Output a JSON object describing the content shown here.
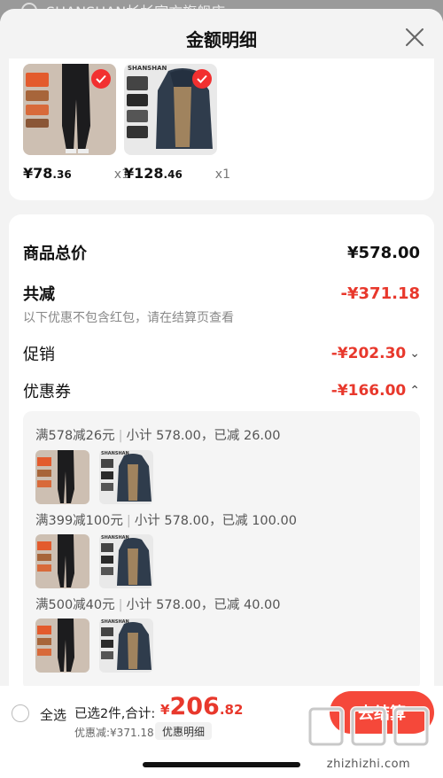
{
  "background_page": {
    "store_name": "SHANSHAN杉杉官方旗舰店 ›"
  },
  "sheet": {
    "title": "金额明细"
  },
  "products": [
    {
      "price_int": "¥78",
      "price_dec": ".36",
      "qty": "x1",
      "brand": ""
    },
    {
      "price_int": "¥128",
      "price_dec": ".46",
      "qty": "x1",
      "brand": "SHANSHAN"
    }
  ],
  "summary": {
    "goods_total_label": "商品总价",
    "goods_total_value": "¥578.00",
    "reduce_label": "共减",
    "reduce_value": "-¥371.18",
    "reduce_note": "以下优惠不包含红包，请在结算页查看",
    "promo_label": "促销",
    "promo_value": "-¥202.30",
    "coupon_label": "优惠券",
    "coupon_value": "-¥166.00"
  },
  "coupons": [
    {
      "rule": "满578减26元",
      "detail": "小计 578.00，已减 26.00"
    },
    {
      "rule": "满399减100元",
      "detail": "小计 578.00，已减 100.00"
    },
    {
      "rule": "满500减40元",
      "detail": "小计 578.00，已减 40.00"
    }
  ],
  "thumb_brand": {
    "name": "SHANSHAN",
    "sub": "杉杉"
  },
  "bottom_bar": {
    "select_all": "全选",
    "selected_count": "已选2件,合计:",
    "total_currency": "¥",
    "total_int": "206",
    "total_dec": ".82",
    "discount": "优惠减:¥371.18",
    "detail_button": "优惠明细",
    "checkout_button": "去结算"
  },
  "watermark": {
    "text": "zhizhizhi.com",
    "logo": "值值值"
  },
  "colors": {
    "accent_red": "#e8382c",
    "check_red": "#f23030"
  }
}
